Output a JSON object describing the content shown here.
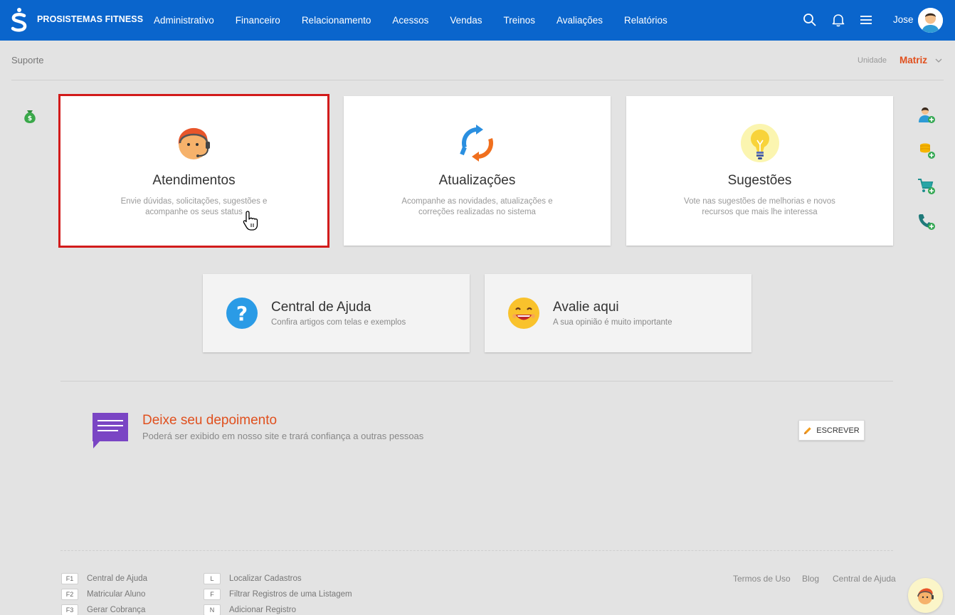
{
  "header": {
    "brand": "PROSISTEMAS FITNESS",
    "nav": [
      "Administrativo",
      "Financeiro",
      "Relacionamento",
      "Acessos",
      "Vendas",
      "Treinos",
      "Avaliações",
      "Relatórios"
    ],
    "username": "Jose"
  },
  "breadcrumb": "Suporte",
  "unit": {
    "label": "Unidade",
    "value": "Matriz"
  },
  "cards": [
    {
      "title": "Atendimentos",
      "desc": "Envie dúvidas, solicitações, sugestões e acompanhe os seus status",
      "icon": "support-agent-icon"
    },
    {
      "title": "Atualizações",
      "desc": "Acompanhe as novidades, atualizações e correções realizadas no sistema",
      "icon": "refresh-icon"
    },
    {
      "title": "Sugestões",
      "desc": "Vote nas sugestões de melhorias e novos recursos que mais lhe interessa",
      "icon": "lightbulb-icon"
    }
  ],
  "small_cards": [
    {
      "title": "Central de Ajuda",
      "sub": "Confira artigos com telas e exemplos"
    },
    {
      "title": "Avalie aqui",
      "sub": "A sua opinião é muito importante"
    }
  ],
  "testimonial": {
    "title": "Deixe seu depoimento",
    "sub": "Poderá ser exibido em nosso site e trará confiança a outras pessoas",
    "button": "ESCREVER"
  },
  "shortcuts": [
    {
      "key": "F1",
      "label": "Central de Ajuda"
    },
    {
      "key": "F2",
      "label": "Matricular Aluno"
    },
    {
      "key": "F3",
      "label": "Gerar Cobrança"
    },
    {
      "key": "L",
      "label": "Localizar Cadastros"
    },
    {
      "key": "F",
      "label": "Filtrar Registros de uma Listagem"
    },
    {
      "key": "N",
      "label": "Adicionar Registro"
    }
  ],
  "footer_links": [
    "Termos de Uso",
    "Blog",
    "Central de Ajuda"
  ],
  "colors": {
    "primary": "#0a65cc",
    "accent": "#e0501e",
    "selection": "#d21b1b"
  }
}
